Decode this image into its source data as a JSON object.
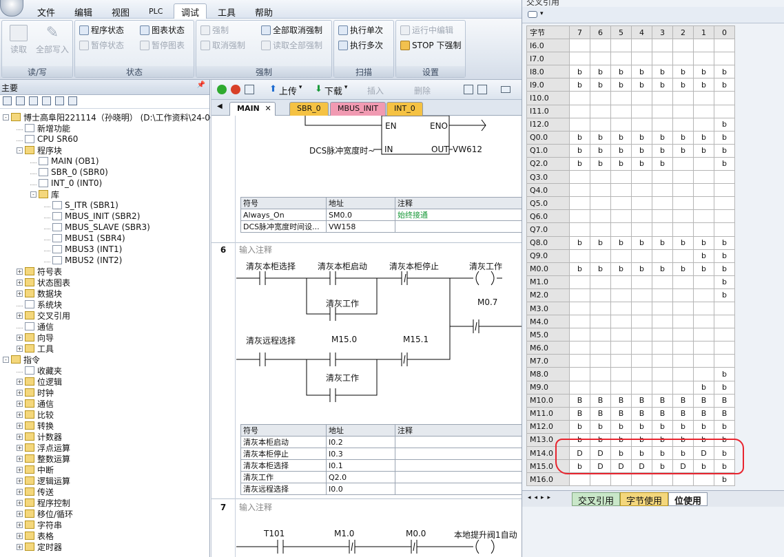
{
  "menu": {
    "items": [
      "文件",
      "编辑",
      "视图",
      "PLC",
      "调试",
      "工具",
      "帮助"
    ],
    "active": "调试"
  },
  "ribbon": {
    "groups": [
      {
        "title": "读/写",
        "buttons": [
          "读取",
          "全部写入"
        ]
      },
      {
        "title": "状态",
        "buttons": [
          "程序状态",
          "图表状态",
          "暂停状态",
          "暂停图表"
        ]
      },
      {
        "title": "强制",
        "buttons": [
          "强制",
          "全部取消强制",
          "取消强制",
          "读取全部强制"
        ]
      },
      {
        "title": "扫描",
        "buttons": [
          "执行单次",
          "执行多次"
        ]
      },
      {
        "title": "设置",
        "buttons": [
          "运行中编辑",
          "STOP 下强制"
        ]
      }
    ]
  },
  "left_panel": {
    "title": "主要",
    "tree": [
      {
        "label": "博士高阜阳221114（孙晓明） (D:\\工作资料\\24-06...",
        "level": 0,
        "toggle": "-"
      },
      {
        "label": "新增功能",
        "level": 1
      },
      {
        "label": "CPU SR60",
        "level": 1
      },
      {
        "label": "程序块",
        "level": 1,
        "toggle": "-"
      },
      {
        "label": "MAIN (OB1)",
        "level": 2
      },
      {
        "label": "SBR_0 (SBR0)",
        "level": 2
      },
      {
        "label": "INT_0 (INT0)",
        "level": 2
      },
      {
        "label": "库",
        "level": 2,
        "toggle": "-"
      },
      {
        "label": "S_ITR (SBR1)",
        "level": 3
      },
      {
        "label": "MBUS_INIT (SBR2)",
        "level": 3
      },
      {
        "label": "MBUS_SLAVE (SBR3)",
        "level": 3
      },
      {
        "label": "MBUS1 (SBR4)",
        "level": 3
      },
      {
        "label": "MBUS3 (INT1)",
        "level": 3
      },
      {
        "label": "MBUS2 (INT2)",
        "level": 3
      },
      {
        "label": "符号表",
        "level": 1,
        "toggle": "+"
      },
      {
        "label": "状态图表",
        "level": 1,
        "toggle": "+"
      },
      {
        "label": "数据块",
        "level": 1,
        "toggle": "+"
      },
      {
        "label": "系统块",
        "level": 1
      },
      {
        "label": "交叉引用",
        "level": 1,
        "toggle": "+"
      },
      {
        "label": "通信",
        "level": 1
      },
      {
        "label": "向导",
        "level": 1,
        "toggle": "+"
      },
      {
        "label": "工具",
        "level": 1,
        "toggle": "+"
      },
      {
        "label": "指令",
        "level": 0,
        "toggle": "-"
      },
      {
        "label": "收藏夹",
        "level": 1
      },
      {
        "label": "位逻辑",
        "level": 1,
        "toggle": "+"
      },
      {
        "label": "时钟",
        "level": 1,
        "toggle": "+"
      },
      {
        "label": "通信",
        "level": 1,
        "toggle": "+"
      },
      {
        "label": "比较",
        "level": 1,
        "toggle": "+"
      },
      {
        "label": "转换",
        "level": 1,
        "toggle": "+"
      },
      {
        "label": "计数器",
        "level": 1,
        "toggle": "+"
      },
      {
        "label": "浮点运算",
        "level": 1,
        "toggle": "+"
      },
      {
        "label": "整数运算",
        "level": 1,
        "toggle": "+"
      },
      {
        "label": "中断",
        "level": 1,
        "toggle": "+"
      },
      {
        "label": "逻辑运算",
        "level": 1,
        "toggle": "+"
      },
      {
        "label": "传送",
        "level": 1,
        "toggle": "+"
      },
      {
        "label": "程序控制",
        "level": 1,
        "toggle": "+"
      },
      {
        "label": "移位/循环",
        "level": 1,
        "toggle": "+"
      },
      {
        "label": "字符串",
        "level": 1,
        "toggle": "+"
      },
      {
        "label": "表格",
        "level": 1,
        "toggle": "+"
      },
      {
        "label": "定时器",
        "level": 1,
        "toggle": "+"
      }
    ]
  },
  "editor": {
    "toolbar": {
      "upload": "上传",
      "download": "下载",
      "insert": "插入",
      "delete": "删除"
    },
    "tabs": [
      "MAIN",
      "SBR_0",
      "MBUS_INIT",
      "INT_0"
    ],
    "net5": {
      "en": "EN",
      "eno": "ENO",
      "in_label": "DCS脉冲宽度时~",
      "in": "IN",
      "out": "OUT",
      "out_addr": "VW612",
      "symbols_header": [
        "符号",
        "地址",
        "注释"
      ],
      "symbols": [
        [
          "Always_On",
          "SM0.0",
          "始终接通"
        ],
        [
          "DCS脉冲宽度时间设...",
          "VW158",
          ""
        ]
      ]
    },
    "net6": {
      "number": "6",
      "comment": "输入注释",
      "contacts": {
        "c1": "清灰本柜选择",
        "c2": "清灰本柜启动",
        "c3": "清灰本柜停止",
        "coil": "清灰工作",
        "par": "清灰工作",
        "m07": "M0.7",
        "c4": "清灰远程选择",
        "m150": "M15.0",
        "m151": "M15.1",
        "par2": "清灰工作"
      },
      "symbols_header": [
        "符号",
        "地址",
        "注释"
      ],
      "symbols": [
        [
          "清灰本柜启动",
          "I0.2",
          ""
        ],
        [
          "清灰本柜停止",
          "I0.3",
          ""
        ],
        [
          "清灰本柜选择",
          "I0.1",
          ""
        ],
        [
          "清灰工作",
          "Q2.0",
          ""
        ],
        [
          "清灰远程选择",
          "I0.0",
          ""
        ]
      ]
    },
    "net7": {
      "number": "7",
      "comment": "输入注释",
      "contacts": {
        "t101": "T101",
        "m10": "M1.0",
        "m00": "M0.0",
        "coil": "本地提升阀1自动"
      }
    }
  },
  "right_panel": {
    "title": "交叉引用",
    "header": [
      "字节",
      "7",
      "6",
      "5",
      "4",
      "3",
      "2",
      "1",
      "0"
    ],
    "rows": [
      [
        "I6.0",
        "",
        "",
        "",
        "",
        "",
        "",
        "",
        ""
      ],
      [
        "I7.0",
        "",
        "",
        "",
        "",
        "",
        "",
        "",
        ""
      ],
      [
        "I8.0",
        "b",
        "b",
        "b",
        "b",
        "b",
        "b",
        "b",
        "b"
      ],
      [
        "I9.0",
        "b",
        "b",
        "b",
        "b",
        "b",
        "b",
        "b",
        "b"
      ],
      [
        "I10.0",
        "",
        "",
        "",
        "",
        "",
        "",
        "",
        ""
      ],
      [
        "I11.0",
        "",
        "",
        "",
        "",
        "",
        "",
        "",
        ""
      ],
      [
        "I12.0",
        "",
        "",
        "",
        "",
        "",
        "",
        "",
        "b"
      ],
      [
        "Q0.0",
        "b",
        "b",
        "b",
        "b",
        "b",
        "b",
        "b",
        "b"
      ],
      [
        "Q1.0",
        "b",
        "b",
        "b",
        "b",
        "b",
        "b",
        "b",
        "b"
      ],
      [
        "Q2.0",
        "b",
        "b",
        "b",
        "b",
        "b",
        "",
        "",
        "b"
      ],
      [
        "Q3.0",
        "",
        "",
        "",
        "",
        "",
        "",
        "",
        ""
      ],
      [
        "Q4.0",
        "",
        "",
        "",
        "",
        "",
        "",
        "",
        ""
      ],
      [
        "Q5.0",
        "",
        "",
        "",
        "",
        "",
        "",
        "",
        ""
      ],
      [
        "Q6.0",
        "",
        "",
        "",
        "",
        "",
        "",
        "",
        ""
      ],
      [
        "Q7.0",
        "",
        "",
        "",
        "",
        "",
        "",
        "",
        ""
      ],
      [
        "Q8.0",
        "b",
        "b",
        "b",
        "b",
        "b",
        "b",
        "b",
        "b"
      ],
      [
        "Q9.0",
        "",
        "",
        "",
        "",
        "",
        "",
        "b",
        "b"
      ],
      [
        "M0.0",
        "b",
        "b",
        "b",
        "b",
        "b",
        "b",
        "b",
        "b"
      ],
      [
        "M1.0",
        "",
        "",
        "",
        "",
        "",
        "",
        "",
        "b"
      ],
      [
        "M2.0",
        "",
        "",
        "",
        "",
        "",
        "",
        "",
        "b"
      ],
      [
        "M3.0",
        "",
        "",
        "",
        "",
        "",
        "",
        "",
        ""
      ],
      [
        "M4.0",
        "",
        "",
        "",
        "",
        "",
        "",
        "",
        ""
      ],
      [
        "M5.0",
        "",
        "",
        "",
        "",
        "",
        "",
        "",
        ""
      ],
      [
        "M6.0",
        "",
        "",
        "",
        "",
        "",
        "",
        "",
        ""
      ],
      [
        "M7.0",
        "",
        "",
        "",
        "",
        "",
        "",
        "",
        ""
      ],
      [
        "M8.0",
        "",
        "",
        "",
        "",
        "",
        "",
        "",
        "b"
      ],
      [
        "M9.0",
        "",
        "",
        "",
        "",
        "",
        "",
        "b",
        "b"
      ],
      [
        "M10.0",
        "B",
        "B",
        "B",
        "B",
        "B",
        "B",
        "B",
        "B"
      ],
      [
        "M11.0",
        "B",
        "B",
        "B",
        "B",
        "B",
        "B",
        "B",
        "B"
      ],
      [
        "M12.0",
        "b",
        "b",
        "b",
        "b",
        "b",
        "b",
        "b",
        "b"
      ],
      [
        "M13.0",
        "b",
        "b",
        "b",
        "b",
        "b",
        "b",
        "b",
        "b"
      ],
      [
        "M14.0",
        "D",
        "D",
        "b",
        "b",
        "b",
        "b",
        "D",
        "b"
      ],
      [
        "M15.0",
        "b",
        "D",
        "D",
        "D",
        "b",
        "D",
        "b",
        "b"
      ],
      [
        "M16.0",
        "",
        "",
        "",
        "",
        "",
        "",
        "",
        "b"
      ]
    ],
    "tabs": [
      "交叉引用",
      "字节使用",
      "位使用"
    ],
    "active_tab": "位使用",
    "annotation_color": "#e8242e"
  }
}
